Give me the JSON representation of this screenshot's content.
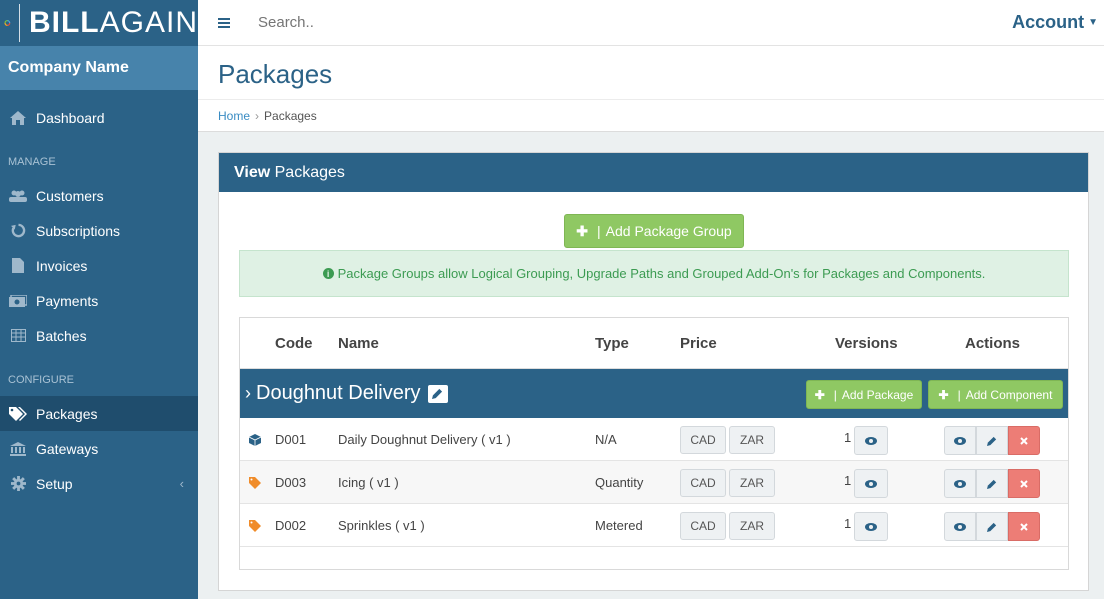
{
  "brand": {
    "logo_bold": "BILL",
    "logo_light": "AGAIN",
    "company": "Company Name"
  },
  "topbar": {
    "search_placeholder": "Search..",
    "account_label": "Account"
  },
  "nav": {
    "dashboard": "Dashboard",
    "manage_header": "MANAGE",
    "customers": "Customers",
    "subscriptions": "Subscriptions",
    "invoices": "Invoices",
    "payments": "Payments",
    "batches": "Batches",
    "configure_header": "CONFIGURE",
    "packages": "Packages",
    "gateways": "Gateways",
    "setup": "Setup"
  },
  "page": {
    "title": "Packages",
    "breadcrumb_home": "Home",
    "breadcrumb_current": "Packages"
  },
  "panel": {
    "title_bold": "View",
    "title_rest": " Packages",
    "add_group_label": "Add Package Group",
    "alert_text": "Package Groups allow Logical Grouping, Upgrade Paths and Grouped Add-On's for Packages and Components."
  },
  "table": {
    "headers": {
      "code": "Code",
      "name": "Name",
      "type": "Type",
      "price": "Price",
      "versions": "Versions",
      "actions": "Actions"
    },
    "group": {
      "name": "Doughnut Delivery",
      "add_package": "Add Package",
      "add_component": "Add Component"
    },
    "rows": [
      {
        "code": "D001",
        "name": "Daily Doughnut Delivery ( v1 )",
        "type": "N/A",
        "cur1": "CAD",
        "cur2": "ZAR",
        "versions": "1"
      },
      {
        "code": "D003",
        "name": "Icing ( v1 )",
        "type": "Quantity",
        "cur1": "CAD",
        "cur2": "ZAR",
        "versions": "1"
      },
      {
        "code": "D002",
        "name": "Sprinkles ( v1 )",
        "type": "Metered",
        "cur1": "CAD",
        "cur2": "ZAR",
        "versions": "1"
      }
    ]
  },
  "colors": {
    "sidebar": "#2b6287",
    "accent_green": "#8fc863",
    "delete_red": "#ed7d76"
  }
}
